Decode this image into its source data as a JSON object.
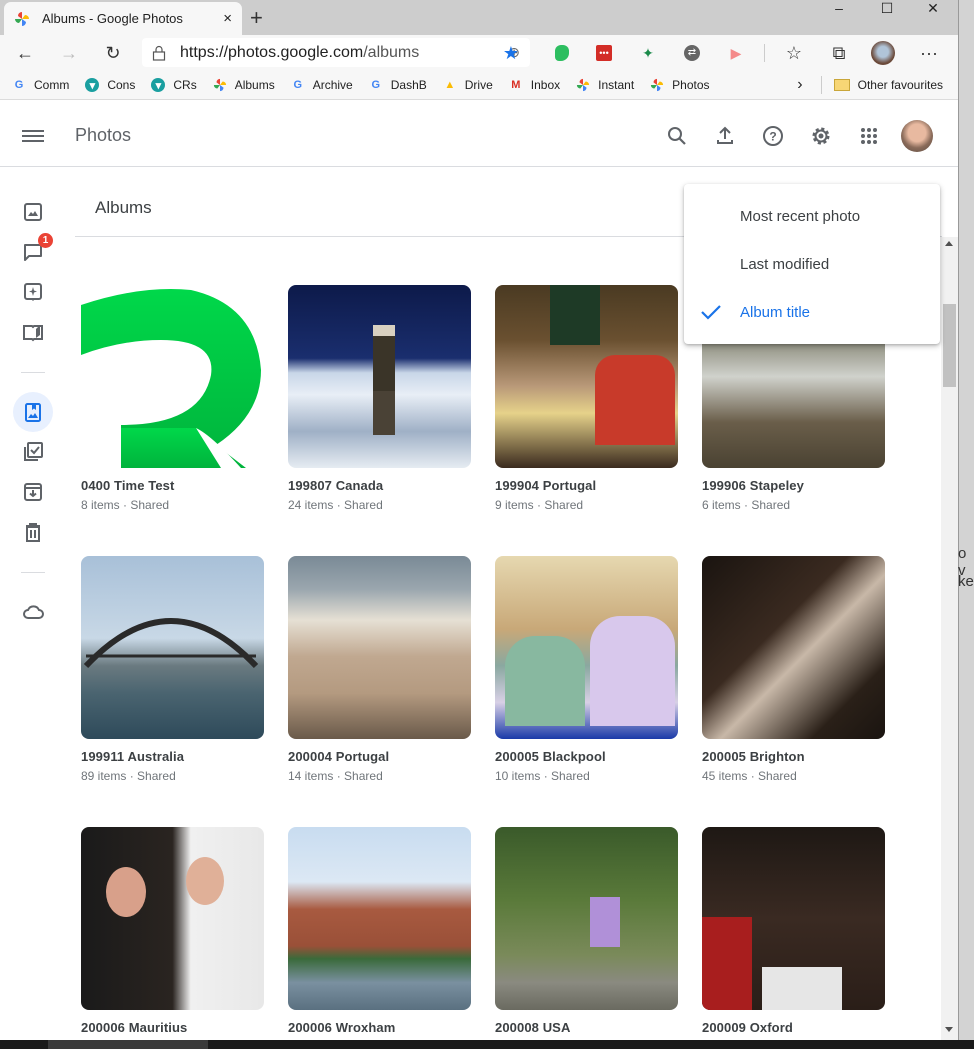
{
  "browser": {
    "tab_title": "Albums - Google Photos",
    "tab_close": "×",
    "new_tab": "+",
    "window_controls": {
      "minimize": "–",
      "maximize": "☐",
      "close": "✕"
    },
    "url_scheme_host": "https://photos.google.com",
    "url_path": "/albums",
    "bookmarks": [
      {
        "label": "Comm",
        "icon": "google-icon"
      },
      {
        "label": "Cons",
        "icon": "teal-circle-icon"
      },
      {
        "label": "CRs",
        "icon": "teal-circle-icon"
      },
      {
        "label": "Albums",
        "icon": "photos-pinwheel-icon"
      },
      {
        "label": "Archive",
        "icon": "google-icon"
      },
      {
        "label": "DashB",
        "icon": "google-icon"
      },
      {
        "label": "Drive",
        "icon": "drive-icon"
      },
      {
        "label": "Inbox",
        "icon": "gmail-icon"
      },
      {
        "label": "Instant",
        "icon": "photos-pinwheel-icon"
      },
      {
        "label": "Photos",
        "icon": "photos-pinwheel-icon"
      }
    ],
    "bookmarks_overflow": "›",
    "other_favourites": "Other favourites",
    "more": "···"
  },
  "app": {
    "title": "Photos",
    "section_title": "Albums",
    "notification_count": "1"
  },
  "sort_menu": {
    "options": [
      {
        "label": "Most recent photo",
        "selected": false
      },
      {
        "label": "Last modified",
        "selected": false
      },
      {
        "label": "Album title",
        "selected": true
      }
    ],
    "accent": "#1a73e8"
  },
  "albums": [
    {
      "title": "0400 Time Test",
      "count": "8 items",
      "status": "Shared"
    },
    {
      "title": "199807 Canada",
      "count": "24 items",
      "status": "Shared"
    },
    {
      "title": "199904 Portugal",
      "count": "9 items",
      "status": "Shared"
    },
    {
      "title": "199906 Stapeley",
      "count": "6 items",
      "status": "Shared"
    },
    {
      "title": "199911 Australia",
      "count": "89 items",
      "status": "Shared"
    },
    {
      "title": "200004 Portugal",
      "count": "14 items",
      "status": "Shared"
    },
    {
      "title": "200005 Blackpool",
      "count": "10 items",
      "status": "Shared"
    },
    {
      "title": "200005 Brighton",
      "count": "45 items",
      "status": "Shared"
    },
    {
      "title": "200006 Mauritius",
      "count": "",
      "status": ""
    },
    {
      "title": "200006 Wroxham",
      "count": "",
      "status": ""
    },
    {
      "title": "200008 USA",
      "count": "",
      "status": ""
    },
    {
      "title": "200009 Oxford",
      "count": "",
      "status": ""
    }
  ],
  "separator": "·",
  "edge_text": {
    "line1": "o v",
    "line2": "ke"
  }
}
